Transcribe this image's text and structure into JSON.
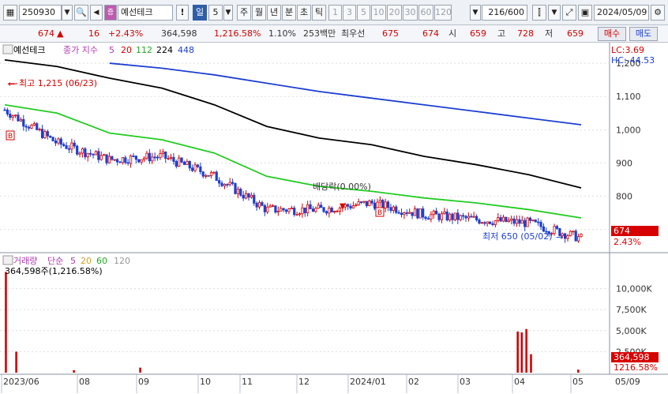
{
  "toolbar": {
    "code": "250930",
    "stock_name": "예선테크",
    "exclaim": "!",
    "period_day": "일",
    "period_num": "5",
    "period_week": "주",
    "period_month": "월",
    "period_year": "년",
    "period_minute": "분",
    "period_second": "초",
    "period_tick": "틱",
    "intervals": [
      "1",
      "3",
      "5",
      "10",
      "20",
      "30",
      "60",
      "120"
    ],
    "count": "216/600",
    "date": "2024/05/09"
  },
  "quote": {
    "price": "674",
    "direction": "▲",
    "change": "16",
    "change_pct": "+2.43%",
    "volume": "364,598",
    "volume_ratio": "1,216.58%",
    "turnover_pct": "1.10%",
    "amount": "253백만",
    "low_label": "최우선",
    "ask": "675",
    "bid": "674",
    "open_label": "시",
    "open": "659",
    "high_label": "고",
    "high": "728",
    "low_label2": "저",
    "low": "659",
    "buy_button": "매수",
    "sell_button": "매도"
  },
  "colors": {
    "up": "#d60000",
    "down": "#1c3fd1",
    "ma5": "#d60000",
    "ma20": "#d60000",
    "ma112": "#22cc22",
    "ma224": "#000000",
    "ma448": "#1c3fd1"
  },
  "chart_data": [
    {
      "type": "line",
      "title": "예선테크",
      "legend": {
        "label": "종가 지수",
        "periods": [
          "5",
          "20",
          "112",
          "224",
          "448"
        ]
      },
      "y_ticks": [
        "1,200",
        "1,100",
        "1,000",
        "900",
        "800",
        "700"
      ],
      "ylim": [
        640,
        1250
      ],
      "x": [
        "2023/06",
        "2023/07",
        "2023/08",
        "2023/09",
        "2023/10",
        "2023/11",
        "2023/12",
        "2024/01",
        "2024/02",
        "2024/03",
        "2024/04",
        "2024/05"
      ],
      "series": [
        {
          "name": "close",
          "values": [
            1060,
            960,
            910,
            920,
            860,
            760,
            760,
            780,
            745,
            730,
            720,
            674
          ]
        },
        {
          "name": "112",
          "values": [
            1075,
            1050,
            990,
            970,
            930,
            860,
            830,
            815,
            795,
            780,
            760,
            735
          ]
        },
        {
          "name": "224",
          "values": [
            1210,
            1190,
            1155,
            1125,
            1075,
            1010,
            975,
            955,
            920,
            895,
            865,
            825
          ]
        },
        {
          "name": "448",
          "values": [
            null,
            null,
            1200,
            1185,
            1165,
            1140,
            1115,
            1095,
            1075,
            1055,
            1035,
            1015
          ]
        }
      ],
      "annotations": {
        "high": "최고 1,215 (06/23)",
        "low": "최저 650 (05/02)",
        "dividend": "배당락(0.00%)",
        "lc": "LC:3.69",
        "hc": "HC:-44.53",
        "last_price": "674",
        "last_pct": "2.43%"
      }
    },
    {
      "type": "bar",
      "title": "거래량",
      "legend": {
        "label": "단순",
        "periods": [
          "5",
          "20",
          "60",
          "120"
        ]
      },
      "current_label": "364,598주(1,216.58%)",
      "y_ticks": [
        "10,000K",
        "7,500K",
        "5,000K",
        "2,500K"
      ],
      "ylim": [
        0,
        12500
      ],
      "categories": [
        "06/02",
        "06/23",
        "07/01",
        "09/01",
        "04/01",
        "04/05",
        "04/10",
        "04/15",
        "05/09"
      ],
      "values": [
        12000,
        2500,
        300,
        600,
        4900,
        4800,
        5200,
        2200,
        365
      ],
      "last_value": "364,598",
      "last_pct": "1216.58%"
    }
  ],
  "x_axis_labels": [
    "2023/06",
    "08",
    "09",
    "10",
    "11",
    "12",
    "2024/01",
    "02",
    "03",
    "04",
    "05",
    "05/09"
  ]
}
